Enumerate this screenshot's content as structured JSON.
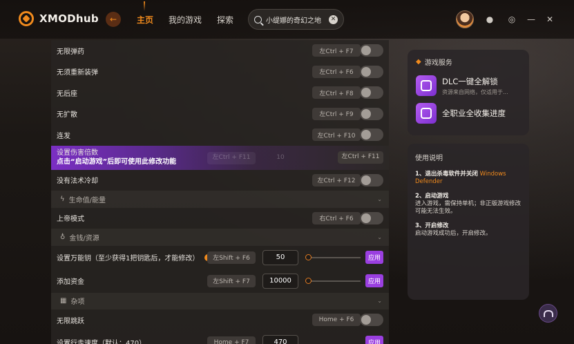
{
  "app": {
    "logo_text": "XMODhub"
  },
  "nav": {
    "items": [
      "主页",
      "我的游戏",
      "探索"
    ],
    "active": "主页"
  },
  "search": {
    "value": "小缇娜的奇幻之地"
  },
  "list": {
    "rows_top": [
      {
        "label": "无限弹药",
        "key": "左Ctrl + F7"
      },
      {
        "label": "无须重新装弹",
        "key": "左Ctrl + F6"
      },
      {
        "label": "无后座",
        "key": "左Ctrl + F8"
      },
      {
        "label": "无扩散",
        "key": "左Ctrl + F9"
      },
      {
        "label": "连发",
        "key": "左Ctrl + F10"
      }
    ],
    "highlight": {
      "label": "设置伤害倍数",
      "hint": "点击“启动游戏”后即可使用此修改功能",
      "ghost_key": "左Ctrl + F11",
      "ghost_value": "10",
      "key": "左Ctrl + F11"
    },
    "row_mana": {
      "label": "没有法术冷却",
      "key": "左Ctrl + F12"
    },
    "section_health": {
      "label": "生命值/能量"
    },
    "row_god": {
      "label": "上帝模式",
      "key": "右Ctrl + F6"
    },
    "section_money": {
      "label": "金钱/资源"
    },
    "row_keys": {
      "label": "设置万能钥（至少获得1把钥匙后，才能修改）",
      "key": "左Shift + F6",
      "value": "50",
      "apply": "应用"
    },
    "row_cash": {
      "label": "添加资金",
      "key": "左Shift + F7",
      "value": "10000",
      "apply": "应用"
    },
    "section_misc": {
      "label": "杂项"
    },
    "row_jump": {
      "label": "无限跳跃",
      "key": "Home + F6"
    },
    "row_partial": {
      "label": "设置行走速度（默认：470）",
      "key": "Home + F7",
      "value": "470",
      "apply": "应用"
    }
  },
  "services": {
    "title": "游戏服务",
    "items": [
      {
        "name": "DLC一键全解锁",
        "sub": "资源来自网络，仅适用于..."
      },
      {
        "name": "全职业全收集进度"
      }
    ]
  },
  "usage": {
    "title": "使用说明",
    "step1_title": "1、退出杀毒软件并关闭",
    "step1_highlight": "Windows Defender",
    "step2_title": "2、启动游戏",
    "step2_body": "进入游戏，需保持单机；非正版游戏修改可能无法生效。",
    "step3_title": "3、开启修改",
    "step3_body": "启动游戏成功后，开启修改。"
  },
  "colors": {
    "accent": "#f08a1d",
    "purple": "#9a3fe0"
  }
}
